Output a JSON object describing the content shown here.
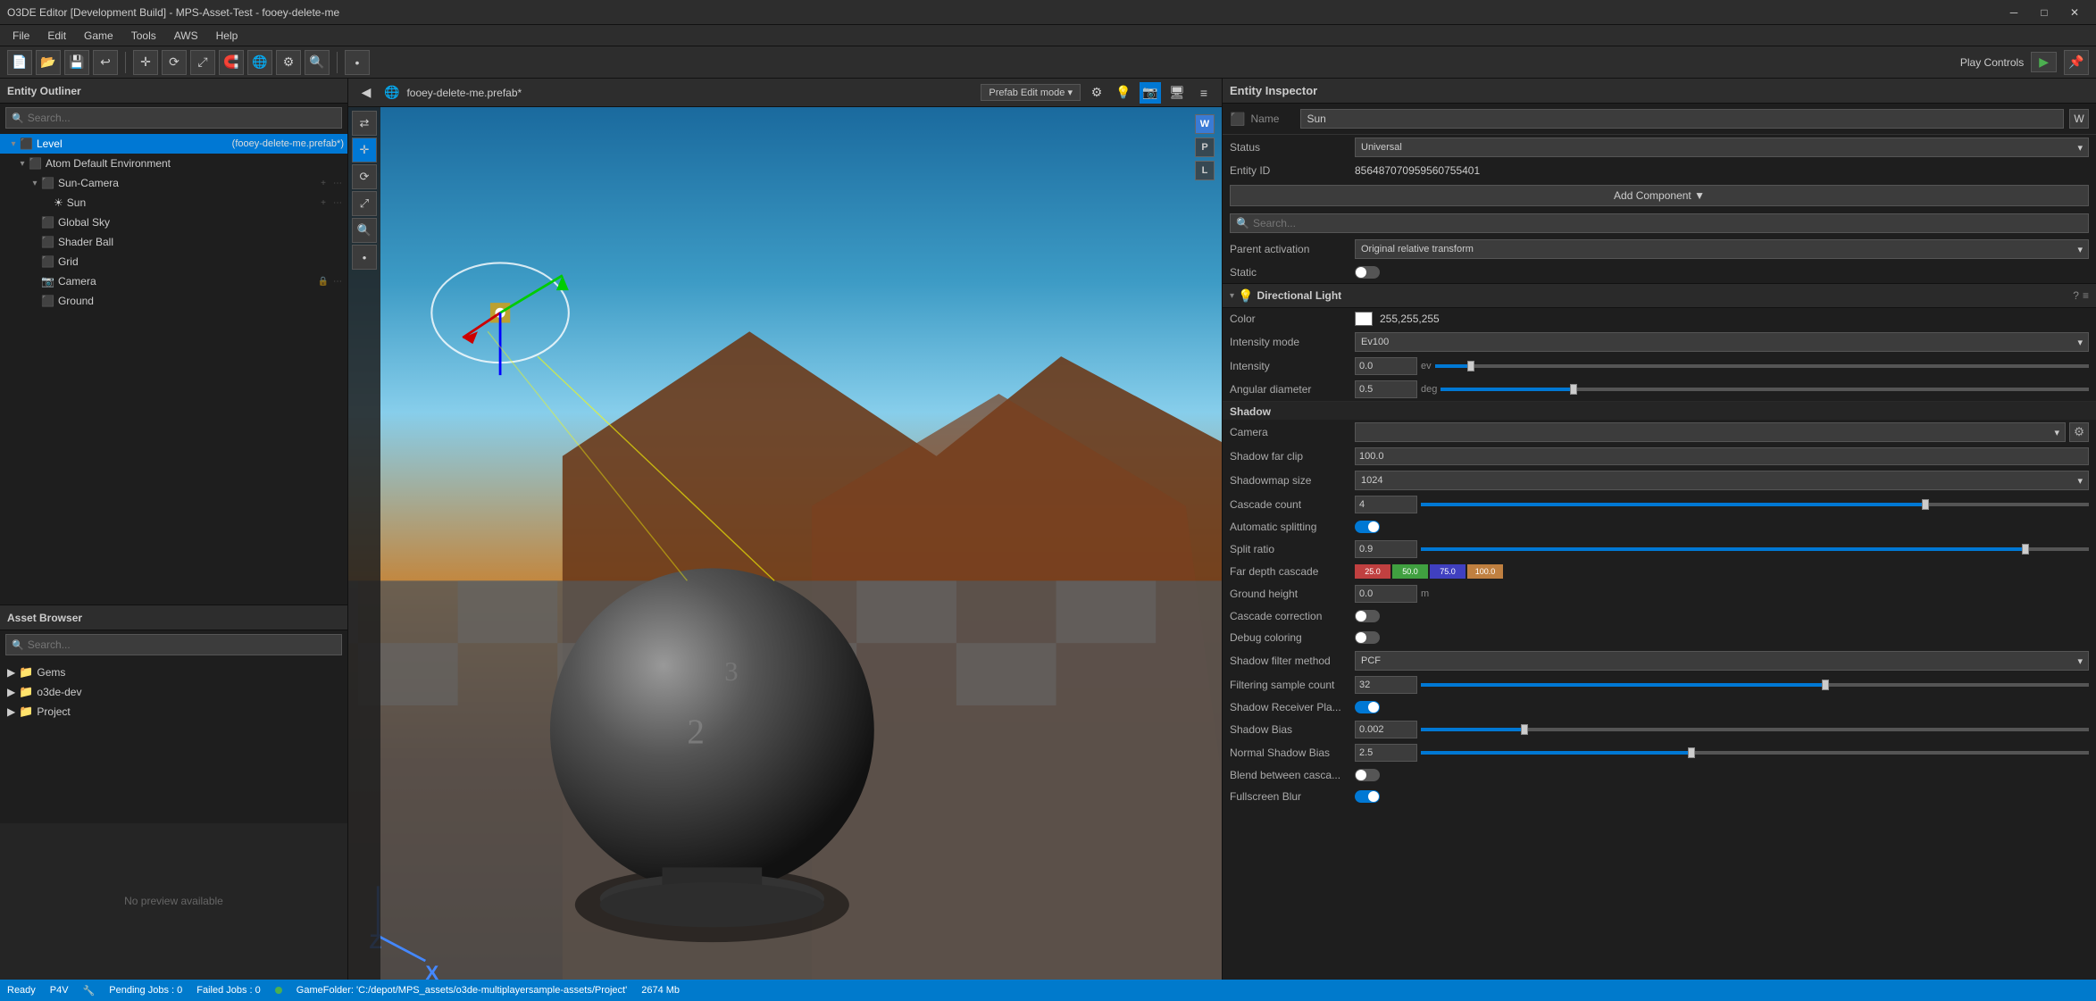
{
  "window": {
    "title": "O3DE Editor [Development Build] - MPS-Asset-Test - fooey-delete-me"
  },
  "titlebar": {
    "minimize": "─",
    "maximize": "□",
    "close": "✕"
  },
  "menubar": {
    "items": [
      "File",
      "Edit",
      "Game",
      "Tools",
      "AWS",
      "Help"
    ]
  },
  "toolbar": {
    "play_controls_label": "Play Controls",
    "play_btn": "▶",
    "pin_btn": "📌"
  },
  "viewport": {
    "back_btn": "◀",
    "tab_label": "fooey-delete-me.prefab*",
    "tab_icon": "🌐",
    "mode_label": "Prefab Edit mode",
    "mode_arrow": "▾",
    "ctrl_w": "W",
    "ctrl_p": "P",
    "ctrl_l": "L",
    "right_tools": [
      "W",
      "P",
      "L"
    ]
  },
  "tools": {
    "transform": "Transform",
    "tool_icons": [
      "↩",
      "✛",
      "⟳",
      "⤢",
      "🔍",
      "•"
    ]
  },
  "entity_outliner": {
    "title": "Entity Outliner",
    "search_placeholder": "Search...",
    "items": [
      {
        "id": "level",
        "label": "Level",
        "sub": "(fooey-delete-me.prefab*)",
        "depth": 0,
        "expand": "▾",
        "selected": true
      },
      {
        "id": "atom-default",
        "label": "Atom Default Environment",
        "depth": 1,
        "expand": "▾"
      },
      {
        "id": "sun-camera",
        "label": "Sun-Camera",
        "depth": 2,
        "expand": "▾"
      },
      {
        "id": "sun",
        "label": "Sun",
        "depth": 3,
        "expand": " ",
        "icon": "☀"
      },
      {
        "id": "global-sky",
        "label": "Global Sky",
        "depth": 2,
        "expand": " "
      },
      {
        "id": "shader-ball",
        "label": "Shader Ball",
        "depth": 2,
        "expand": " "
      },
      {
        "id": "grid",
        "label": "Grid",
        "depth": 2,
        "expand": " "
      },
      {
        "id": "camera",
        "label": "Camera",
        "depth": 2,
        "expand": " "
      },
      {
        "id": "ground",
        "label": "Ground",
        "depth": 2,
        "expand": " "
      }
    ]
  },
  "asset_browser": {
    "title": "Asset Browser",
    "search_placeholder": "Search...",
    "items": [
      {
        "id": "gems",
        "label": "Gems",
        "depth": 0,
        "expand": "▶"
      },
      {
        "id": "o3de-dev",
        "label": "o3de-dev",
        "depth": 0,
        "expand": "▶"
      },
      {
        "id": "project",
        "label": "Project",
        "depth": 0,
        "expand": "▶"
      }
    ],
    "no_preview": "No preview available"
  },
  "entity_inspector": {
    "title": "Entity Inspector",
    "name_label": "Name",
    "name_value": "Sun",
    "status_label": "Status",
    "status_value": "Universal",
    "entity_id_label": "Entity ID",
    "entity_id_value": "856487070959560755401",
    "add_component_label": "Add Component ▼",
    "search_placeholder": "Search...",
    "parent_activation_label": "Parent activation",
    "parent_activation_value": "Original relative transform",
    "static_label": "Static",
    "directional_light": {
      "title": "Directional Light",
      "color_label": "Color",
      "color_value": "255,255,255",
      "intensity_mode_label": "Intensity mode",
      "intensity_mode_value": "Ev100",
      "intensity_label": "Intensity",
      "intensity_value": "0.0",
      "intensity_unit": "ev",
      "angular_diameter_label": "Angular diameter",
      "angular_diameter_value": "0.5",
      "angular_diameter_unit": "deg",
      "shadow_section": "Shadow",
      "camera_label": "Camera",
      "shadow_far_clip_label": "Shadow far clip",
      "shadow_far_clip_value": "100.0",
      "shadowmap_size_label": "Shadowmap size",
      "shadowmap_size_value": "1024",
      "cascade_count_label": "Cascade count",
      "cascade_count_value": "4",
      "auto_splitting_label": "Automatic splitting",
      "split_ratio_label": "Split ratio",
      "split_ratio_value": "0.9",
      "far_depth_label": "Far depth cascade",
      "far_depth_segments": [
        {
          "label": "25.0",
          "color": "#e05252"
        },
        {
          "label": "50.0",
          "color": "#52c252"
        },
        {
          "label": "75.0",
          "color": "#5252e0"
        },
        {
          "label": "100.0",
          "color": "#e0a052"
        }
      ],
      "ground_height_label": "Ground height",
      "ground_height_value": "0.0",
      "ground_height_unit": "m",
      "cascade_correction_label": "Cascade correction",
      "debug_coloring_label": "Debug coloring",
      "shadow_filter_label": "Shadow filter method",
      "shadow_filter_value": "PCF",
      "filtering_sample_label": "Filtering sample count",
      "filtering_sample_value": "32",
      "shadow_receiver_label": "Shadow Receiver Pla...",
      "shadow_bias_label": "Shadow Bias",
      "shadow_bias_value": "0.002",
      "normal_shadow_bias_label": "Normal Shadow Bias",
      "normal_shadow_bias_value": "2.5",
      "blend_cascades_label": "Blend between casca...",
      "fullscreen_blur_label": "Fullscreen Blur"
    }
  },
  "status_bar": {
    "source": "P4V",
    "pending_jobs_label": "Pending Jobs : 0",
    "failed_jobs_label": "Failed Jobs : 0",
    "game_folder_label": "GameFolder: 'C:/depot/MPS_assets/o3de-multiplayersample-assets/Project'",
    "memory": "2674 Mb",
    "status": "Ready"
  },
  "colors": {
    "accent": "#0078d4",
    "background": "#1e1e1e",
    "panel": "#2d2d2d",
    "selected": "#0078d4",
    "text": "#cccccc",
    "subtext": "#888888"
  }
}
